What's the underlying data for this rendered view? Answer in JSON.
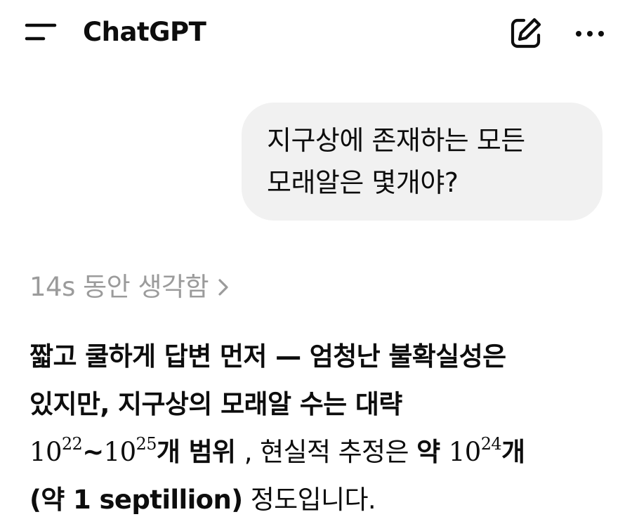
{
  "header": {
    "title": "ChatGPT",
    "menu_icon": "menu-icon",
    "edit_icon": "new-chat-edit-icon",
    "more_icon": "more-options-icon"
  },
  "conversation": {
    "user_message": {
      "line1": "지구상에 존재하는 모든",
      "line2": "모래알은 몇개야?"
    },
    "thinking": {
      "label": "14s 동안 생각함",
      "chevron": ">"
    },
    "answer": {
      "line1": "짧고 쿨하게 답변 먼저 — 엄청난 불확실성은",
      "line2": "있지만, 지구상의 모래알 수는 대략",
      "range_low_base": "10",
      "range_low_exp": "22",
      "range_sep": "~",
      "range_high_base": "10",
      "range_high_exp": "25",
      "range_suffix": "개 범위",
      "line3_mid": ", 현실적 추정은 ",
      "estimate_prefix": "약 ",
      "estimate_base": "10",
      "estimate_exp": "24",
      "estimate_suffix": "개",
      "line4_bold": "(약 1 septillion)",
      "line4_rest": " 정도입니다."
    }
  },
  "colors": {
    "bubble_bg": "#f1f1f1",
    "thinking_text": "#9b9b9b",
    "text": "#0d0d0d"
  }
}
